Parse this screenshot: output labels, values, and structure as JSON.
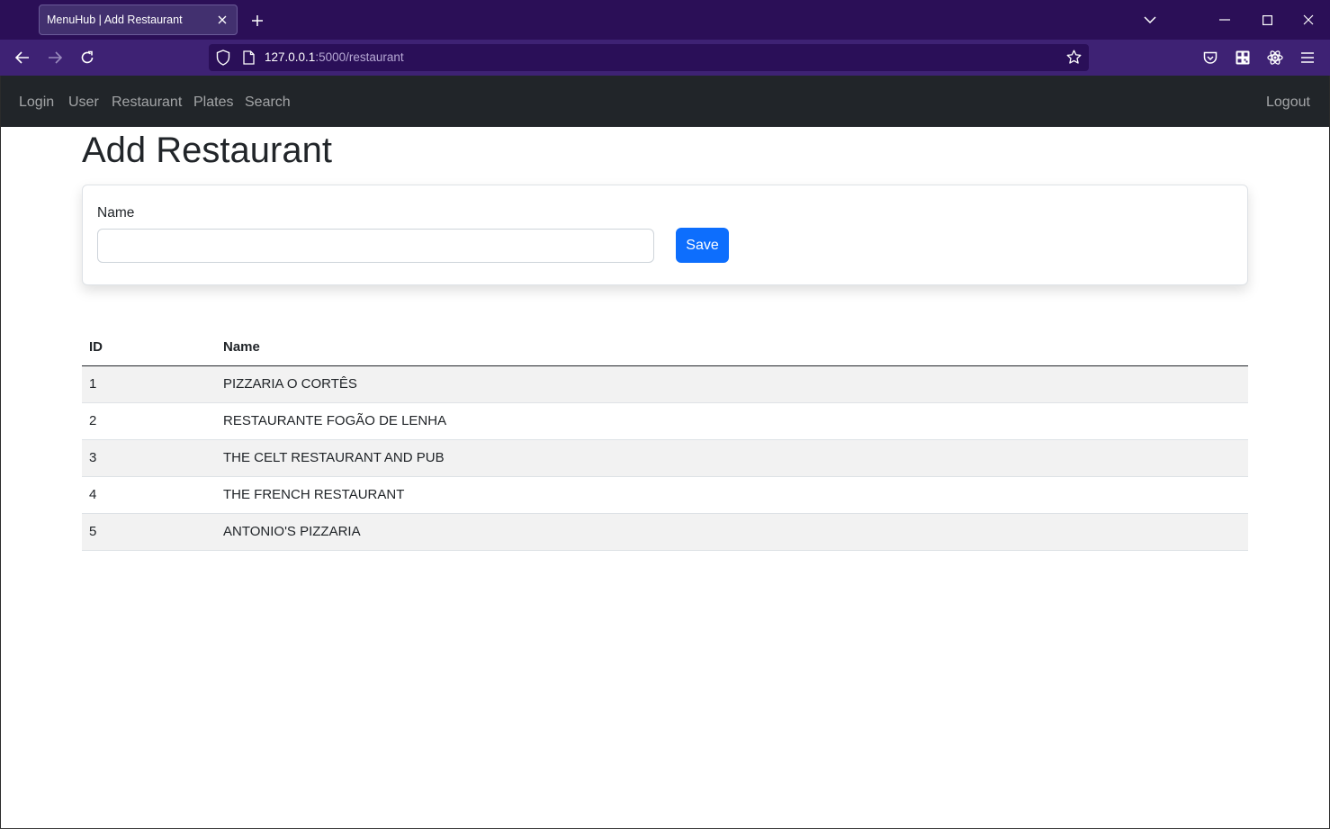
{
  "browser": {
    "tab_title": "MenuHub | Add Restaurant",
    "url_host": "127.0.0.1",
    "url_path": ":5000/restaurant"
  },
  "nav": {
    "items": [
      {
        "label": "Login"
      },
      {
        "label": "User"
      },
      {
        "label": "Restaurant"
      },
      {
        "label": "Plates"
      },
      {
        "label": "Search"
      }
    ],
    "logout": "Logout"
  },
  "page": {
    "title": "Add Restaurant"
  },
  "form": {
    "name_label": "Name",
    "name_value": "",
    "save_label": "Save"
  },
  "table": {
    "headers": [
      "ID",
      "Name"
    ],
    "rows": [
      {
        "id": "1",
        "name": "PIZZARIA O CORTÊS"
      },
      {
        "id": "2",
        "name": "RESTAURANTE FOGÃO DE LENHA"
      },
      {
        "id": "3",
        "name": "THE CELT RESTAURANT AND PUB"
      },
      {
        "id": "4",
        "name": "THE FRENCH RESTAURANT"
      },
      {
        "id": "5",
        "name": "ANTONIO'S PIZZARIA"
      }
    ]
  },
  "icons": {
    "tab_close": "close-icon",
    "new_tab": "plus-icon",
    "tab_list": "chevron-down-icon",
    "minimize": "minimize-icon",
    "maximize": "maximize-icon",
    "close_window": "close-icon",
    "back": "back-arrow-icon",
    "forward": "forward-arrow-icon",
    "reload": "reload-icon",
    "shield": "shield-icon",
    "page": "page-icon",
    "bookmark": "star-icon",
    "pocket": "pocket-icon",
    "qr": "qr-code-icon",
    "extension": "extension-icon",
    "menu": "hamburger-menu-icon"
  },
  "colors": {
    "tabbar": "#2b0f57",
    "toolbar": "#3e2274",
    "app_navbar": "#212529",
    "primary_button": "#0d6efd"
  }
}
